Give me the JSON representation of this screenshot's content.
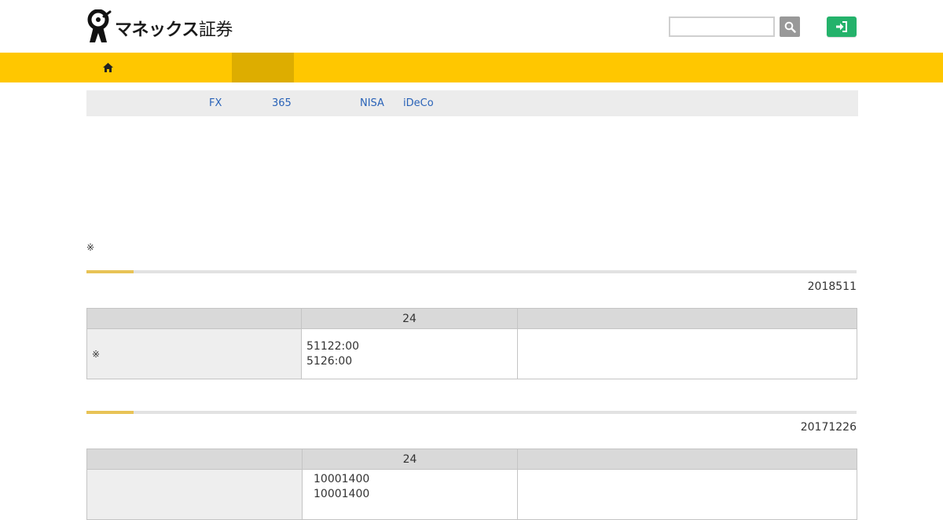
{
  "header": {
    "logo_brand": "マネックス",
    "logo_kanji": "証券",
    "logo_alt": "マネックス証券",
    "search": {
      "value": "",
      "placeholder": ""
    },
    "search_icon": "magnifier-icon",
    "login_icon": "sign-in-icon"
  },
  "navbar": {
    "home_icon": "home-icon",
    "accent_color": "#ffc700",
    "active_color": "#ddad00"
  },
  "subnav": {
    "links": [
      "FX",
      "365",
      "NISA",
      "iDeCo"
    ]
  },
  "note": "※",
  "sections": [
    {
      "date": "2018511",
      "table": {
        "headers": [
          "",
          "24",
          ""
        ],
        "rows": [
          {
            "label": "※",
            "hours": [
              "51122:00",
              "5126:00"
            ],
            "extra": ""
          }
        ]
      }
    },
    {
      "date": "20171226",
      "table": {
        "headers": [
          "",
          "24",
          ""
        ],
        "rows": [
          {
            "label": "",
            "hours": [
              "10001400",
              "10001400"
            ],
            "extra": ""
          }
        ]
      }
    }
  ]
}
